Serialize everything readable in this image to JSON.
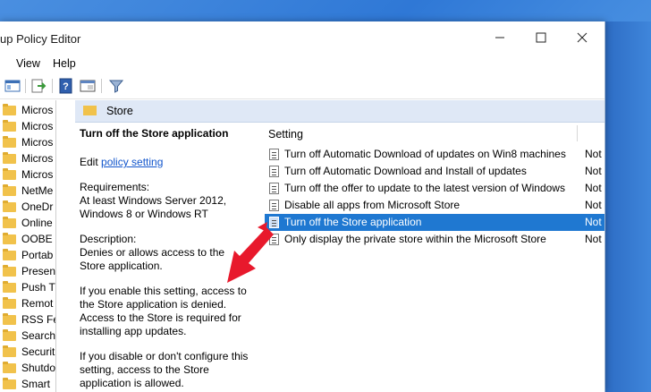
{
  "window": {
    "title": "up Policy Editor"
  },
  "menu": [
    "View",
    "Help"
  ],
  "tree": [
    "Micros",
    "Micros",
    "Micros",
    "Micros",
    "Micros",
    "NetMe",
    "OneDr",
    "Online",
    "OOBE",
    "Portab",
    "Presen",
    "Push T",
    "Remot",
    "RSS Fe",
    "Search",
    "Securit",
    "Shutdo",
    "Smart"
  ],
  "header": {
    "folder": "Store"
  },
  "description": {
    "title": "Turn off the Store application",
    "edit_prefix": "Edit ",
    "edit_link": "policy setting",
    "requirements_label": "Requirements:",
    "requirements": "At least Windows Server 2012, Windows 8 or Windows RT",
    "description_label": "Description:",
    "description": "Denies or allows access to the Store application.",
    "enabled_text": "If you enable this setting, access to the Store application is denied. Access to the Store is required for installing app updates.",
    "disabled_text": "If you disable or don't configure this setting, access to the Store application is allowed."
  },
  "list": {
    "column_setting": "Setting",
    "rows": [
      {
        "name": "Turn off Automatic Download of updates on Win8 machines",
        "state": "Not"
      },
      {
        "name": "Turn off Automatic Download and Install of updates",
        "state": "Not"
      },
      {
        "name": "Turn off the offer to update to the latest version of Windows",
        "state": "Not"
      },
      {
        "name": "Disable all apps from Microsoft Store",
        "state": "Not"
      },
      {
        "name": "Turn off the Store application",
        "state": "Not"
      },
      {
        "name": "Only display the private store within the Microsoft Store",
        "state": "Not"
      }
    ],
    "selected_index": 4
  },
  "colors": {
    "selection": "#1f78d1",
    "annotation_arrow": "#e8192c",
    "header_bg": "#dfe8f6"
  }
}
